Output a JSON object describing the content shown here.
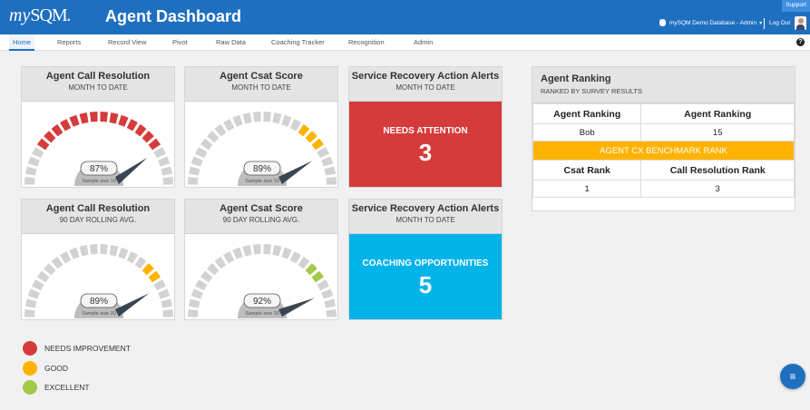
{
  "header": {
    "logo_text_my": "my",
    "logo_text_sqm": "SQM",
    "logo_suffix": ".",
    "title": "Agent Dashboard",
    "support_label": "Support",
    "database_label": "mySQM Demo Database - Admin",
    "logout_label": "Log Out"
  },
  "nav": {
    "items": [
      {
        "label": "Home",
        "active": true
      },
      {
        "label": "Reports"
      },
      {
        "label": "Record View"
      },
      {
        "label": "Pivot"
      },
      {
        "label": "Raw Data"
      },
      {
        "label": "Coaching Tracker"
      },
      {
        "label": "Recognition"
      },
      {
        "label": "Admin"
      }
    ],
    "help_symbol": "?"
  },
  "gauges": [
    {
      "title": "Agent Call Resolution",
      "subtitle": "MONTH TO DATE",
      "value": 87,
      "value_label": "87%",
      "sample_label": "Sample size 10",
      "lit_segments": 14,
      "color": "#d63b3b"
    },
    {
      "title": "Agent Csat Score",
      "subtitle": "MONTH TO DATE",
      "value": 89,
      "value_label": "89%",
      "sample_label": "Sample size 10",
      "lit_segments": 3,
      "color": "#ffb300"
    },
    {
      "title": "Agent Call Resolution",
      "subtitle": "90 DAY ROLLING AVG.",
      "value": 89,
      "value_label": "89%",
      "sample_label": "Sample size 30",
      "lit_segments": 2,
      "color": "#ffb300"
    },
    {
      "title": "Agent Csat Score",
      "subtitle": "90 DAY ROLLING AVG.",
      "value": 92,
      "value_label": "92%",
      "sample_label": "Sample size 30",
      "lit_segments": 2,
      "color": "#a3c94a"
    }
  ],
  "alerts": [
    {
      "title": "Service Recovery Action Alerts",
      "subtitle": "MONTH TO DATE",
      "label": "NEEDS ATTENTION",
      "value": "3",
      "color": "#d63b3b"
    },
    {
      "title": "Service Recovery Action Alerts",
      "subtitle": "MONTH TO DATE",
      "label": "COACHING OPPORTUNITIES",
      "value": "5",
      "color": "#00b3e8"
    }
  ],
  "ranking": {
    "title": "Agent Ranking",
    "subtitle": "RANKED BY SURVEY RESULTS",
    "col1_header": "Agent Ranking",
    "col2_header": "Agent Ranking",
    "col1_value": "Bob",
    "col2_value": "15",
    "benchmark_label": "AGENT CX BENCHMARK RANK",
    "col3_header": "Csat Rank",
    "col4_header": "Call Resolution Rank",
    "col3_value": "1",
    "col4_value": "3"
  },
  "legend": [
    {
      "label": "NEEDS IMPROVEMENT",
      "color": "#d63b3b"
    },
    {
      "label": "GOOD",
      "color": "#ffb300"
    },
    {
      "label": "EXCELLENT",
      "color": "#a3c94a"
    }
  ],
  "fab_icon": "menu-icon",
  "colors": {
    "brand_blue": "#1f6fc0",
    "gauge_grey": "#d2d2d2",
    "needle": "#3b4654"
  }
}
